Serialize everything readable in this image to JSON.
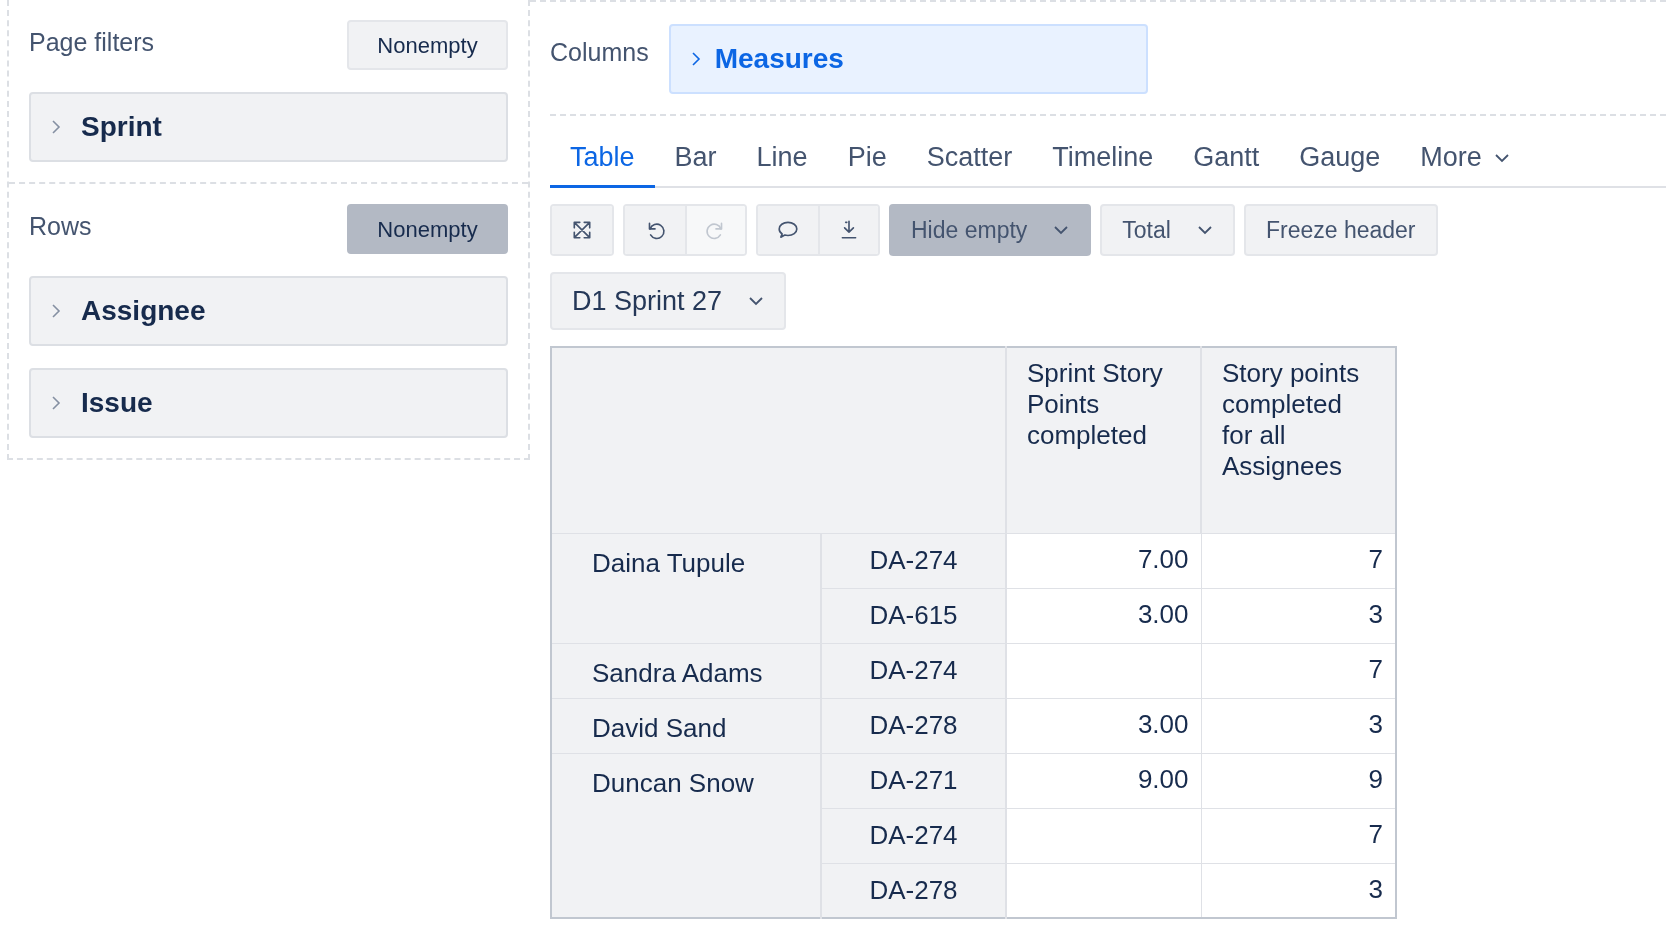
{
  "page_filters": {
    "title": "Page filters",
    "nonempty": {
      "label": "Nonempty",
      "active": false
    },
    "items": [
      "Sprint"
    ]
  },
  "rows_section": {
    "title": "Rows",
    "nonempty": {
      "label": "Nonempty",
      "active": true
    },
    "items": [
      "Assignee",
      "Issue"
    ]
  },
  "columns_section": {
    "title": "Columns",
    "items": [
      "Measures"
    ]
  },
  "tabs": [
    {
      "label": "Table",
      "selected": true
    },
    {
      "label": "Bar",
      "selected": false
    },
    {
      "label": "Line",
      "selected": false
    },
    {
      "label": "Pie",
      "selected": false
    },
    {
      "label": "Scatter",
      "selected": false
    },
    {
      "label": "Timeline",
      "selected": false
    },
    {
      "label": "Gantt",
      "selected": false
    },
    {
      "label": "Gauge",
      "selected": false
    },
    {
      "label": "More",
      "selected": false,
      "dropdown": true
    }
  ],
  "toolbar": {
    "icon_groups": [
      [
        {
          "disabled": false
        }
      ],
      [
        {
          "disabled": false
        },
        {
          "disabled": true
        }
      ],
      [
        {
          "disabled": false
        },
        {
          "disabled": false
        }
      ]
    ],
    "menus": [
      {
        "label": "Hide empty",
        "active": true,
        "dropdown": true
      },
      {
        "label": "Total",
        "active": false,
        "dropdown": true
      },
      {
        "label": "Freeze header",
        "active": false,
        "dropdown": false
      }
    ]
  },
  "page_filter_select": {
    "value": "D1 Sprint 27"
  },
  "table": {
    "columns": [
      "Sprint Story Points completed",
      "Story points completed for all Assignees"
    ],
    "groups": [
      {
        "assignee": "Daina Tupule",
        "rows": [
          {
            "issue": "DA-274",
            "sprint_points": "7.00",
            "all_points": "7"
          },
          {
            "issue": "DA-615",
            "sprint_points": "3.00",
            "all_points": "3"
          }
        ]
      },
      {
        "assignee": "Sandra Adams",
        "rows": [
          {
            "issue": "DA-274",
            "all_points": "7"
          }
        ]
      },
      {
        "assignee": "David Sand",
        "rows": [
          {
            "issue": "DA-278",
            "sprint_points": "3.00",
            "all_points": "3"
          }
        ]
      },
      {
        "assignee": "Duncan Snow",
        "rows": [
          {
            "issue": "DA-271",
            "sprint_points": "9.00",
            "all_points": "9"
          },
          {
            "issue": "DA-274",
            "all_points": "7"
          },
          {
            "issue": "DA-278",
            "all_points": "3"
          }
        ]
      }
    ]
  }
}
